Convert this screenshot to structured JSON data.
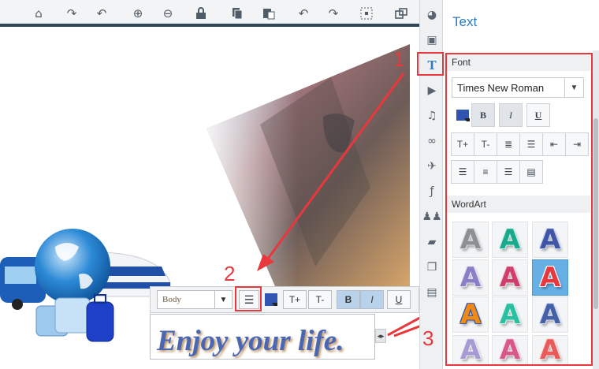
{
  "toolbar": {
    "buttons": [
      {
        "name": "home-button",
        "icon": "home-icon",
        "glyph": "⌂"
      },
      {
        "name": "redo-curve-button",
        "icon": "curved-arrow-icon",
        "glyph": "↷"
      },
      {
        "name": "undo-curve-button",
        "icon": "curved-arrow-back-icon",
        "glyph": "↶"
      },
      {
        "name": "zoom-in-button",
        "icon": "zoom-in-icon",
        "glyph": "⊕"
      },
      {
        "name": "zoom-out-button",
        "icon": "zoom-out-icon",
        "glyph": "⊖"
      },
      {
        "name": "lock-button",
        "icon": "lock-icon",
        "glyph": "🔒"
      },
      {
        "name": "copy-button",
        "icon": "copy-icon",
        "glyph": "❐"
      },
      {
        "name": "paste-button",
        "icon": "paste-icon",
        "glyph": "📋"
      },
      {
        "name": "undo-button",
        "icon": "undo-icon",
        "glyph": "↶"
      },
      {
        "name": "redo-button",
        "icon": "redo-icon",
        "glyph": "↷"
      },
      {
        "name": "select-area-button",
        "icon": "select-area-icon",
        "glyph": "⬚"
      },
      {
        "name": "group-button",
        "icon": "group-icon",
        "glyph": "⧉"
      }
    ]
  },
  "rail": {
    "items": [
      {
        "name": "rail-shapes",
        "icon": "shapes-icon",
        "glyph": "◕"
      },
      {
        "name": "rail-image",
        "icon": "image-icon",
        "glyph": "▣"
      },
      {
        "name": "rail-text",
        "icon": "text-icon",
        "glyph": "T"
      },
      {
        "name": "rail-video",
        "icon": "video-icon",
        "glyph": "▶"
      },
      {
        "name": "rail-music",
        "icon": "music-icon",
        "glyph": "♫"
      },
      {
        "name": "rail-link",
        "icon": "link-icon",
        "glyph": "🔗"
      },
      {
        "name": "rail-flight",
        "icon": "plane-icon",
        "glyph": "✈"
      },
      {
        "name": "rail-flash",
        "icon": "flash-icon",
        "glyph": "ƒ"
      },
      {
        "name": "rail-people",
        "icon": "people-icon",
        "glyph": "👥"
      },
      {
        "name": "rail-hat",
        "icon": "graduation-cap-icon",
        "glyph": "🎓"
      },
      {
        "name": "rail-pages",
        "icon": "pages-icon",
        "glyph": "❐"
      },
      {
        "name": "rail-layout",
        "icon": "layout-icon",
        "glyph": "▤"
      }
    ]
  },
  "panel": {
    "title": "Text",
    "font_section": "Font",
    "font_value": "Times New Roman",
    "wordart_section": "WordArt",
    "wordart_letter": "A",
    "wordart_tiles": [
      {
        "fill": "#8c8f94",
        "stroke": "#d9dbde"
      },
      {
        "fill": "#19a98c",
        "stroke": "#c8efe6"
      },
      {
        "fill": "#3f55a5",
        "stroke": "#c7d0ee"
      },
      {
        "fill": "#8a7fc4",
        "stroke": "#e6e2f7"
      },
      {
        "fill": "#cf3f6b",
        "stroke": "#f5d8e2"
      },
      {
        "fill": "#e8383d",
        "stroke": "#ffffff"
      },
      {
        "fill": "#f08a12",
        "stroke": "#3a56a8"
      },
      {
        "fill": "#2bbfa0",
        "stroke": "#d6f4ee"
      },
      {
        "fill": "#4461a8",
        "stroke": "#d3dcf0"
      },
      {
        "fill": "#a79bd3",
        "stroke": "#eeeaf8"
      },
      {
        "fill": "#d9588a",
        "stroke": "#f6dbe6"
      },
      {
        "fill": "#ea5a5a",
        "stroke": "#fbdcdc"
      }
    ]
  },
  "annotations": {
    "label_1": "1",
    "label_2": "2",
    "label_3": "3",
    "color": "#e8383d"
  },
  "floating_toolbar": {
    "style_value": "Body",
    "list_icon": "list-icon",
    "font_increase": "T+",
    "font_decrease": "T-",
    "bold": "B",
    "italic": "I",
    "underline": "U"
  },
  "canvas": {
    "text": "Enjoy your life."
  },
  "colors": {
    "accent": "#2a7ac8",
    "toolbar_dark": "#2f4656"
  }
}
